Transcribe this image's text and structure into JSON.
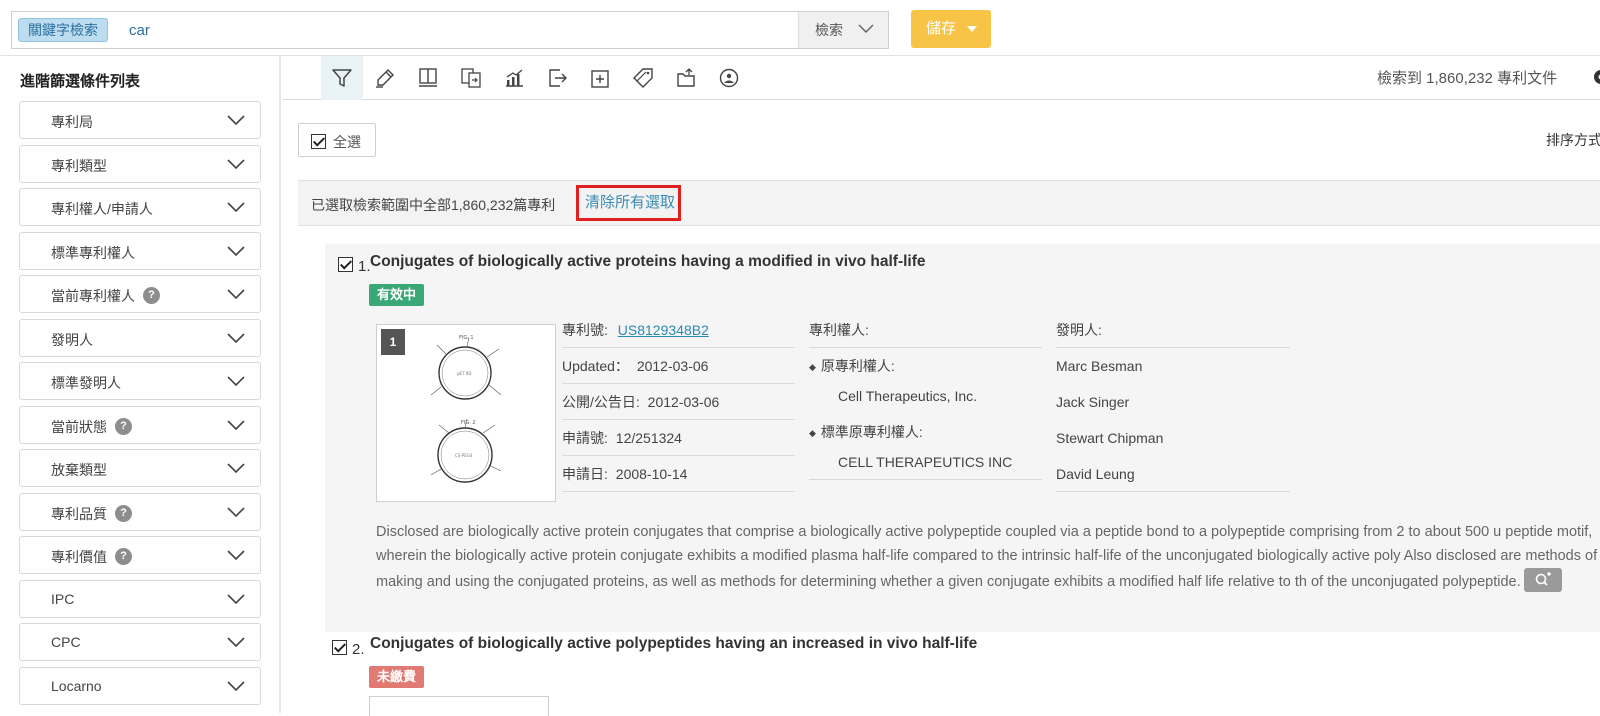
{
  "search": {
    "tag": "關鍵字檢索",
    "value": "car",
    "search_button": "檢索",
    "save_button": "儲存"
  },
  "sidebar": {
    "title": "進階篩選條件列表",
    "items": [
      {
        "label": "專利局",
        "help": false
      },
      {
        "label": "專利類型",
        "help": false
      },
      {
        "label": "專利權人/申請人",
        "help": false
      },
      {
        "label": "標準專利權人",
        "help": false
      },
      {
        "label": "當前專利權人",
        "help": true
      },
      {
        "label": "發明人",
        "help": false
      },
      {
        "label": "標準發明人",
        "help": false
      },
      {
        "label": "當前狀態",
        "help": true
      },
      {
        "label": "放棄類型",
        "help": false
      },
      {
        "label": "專利品質",
        "help": true
      },
      {
        "label": "專利價值",
        "help": true
      },
      {
        "label": "IPC",
        "help": false
      },
      {
        "label": "CPC",
        "help": false
      },
      {
        "label": "Locarno",
        "help": false
      }
    ]
  },
  "toolbar": {
    "tools": [
      "filter-icon",
      "highlighter-icon",
      "reader-icon",
      "compare-icon",
      "analysis-chart-icon",
      "export-icon",
      "add-icon",
      "tag-icon",
      "save-to-folder-icon",
      "monitor-icon"
    ],
    "result_count": "檢索到 1,860,232 專利文件"
  },
  "list": {
    "select_all": "全選",
    "sort_label": "排序方式",
    "selection_text": "已選取檢索範圍中全部1,860,232篇專利",
    "clear_selection": "清除所有選取"
  },
  "results": [
    {
      "num": "1.",
      "title": "Conjugates of biologically active proteins having a modified in vivo half-life",
      "status": "有效中",
      "status_color": "#3aa876",
      "thumb_num": "1",
      "patent_no_label": "專利號:",
      "patent_no": "US8129348B2",
      "updated_label": "Updated：",
      "updated": "2012-03-06",
      "pub_label": "公開/公告日:",
      "pub_date": "2012-03-06",
      "app_no_label": "申請號:",
      "app_no": "12/251324",
      "app_date_label": "申請日:",
      "app_date": "2008-10-14",
      "assignee_label": "專利權人:",
      "orig_assignee_label": "原專利權人:",
      "orig_assignee": "Cell Therapeutics, Inc.",
      "std_orig_assignee_label": "標準原專利權人:",
      "std_orig_assignee": "CELL THERAPEUTICS INC",
      "inventor_label": "發明人:",
      "inventors": [
        "Marc Besman",
        "Jack Singer",
        "Stewart Chipman",
        "David Leung"
      ],
      "abstract": "Disclosed are biologically active protein conjugates that comprise a biologically active polypeptide coupled via a peptide bond to a polypeptide comprising from 2 to about 500 u peptide motif, wherein the biologically active protein conjugate exhibits a modified plasma half-life compared to the intrinsic half-life of the unconjugated biologically active poly Also disclosed are methods of making and using the conjugated proteins, as well as methods for determining whether a given conjugate exhibits a modified half life relative to th of the unconjugated polypeptide."
    },
    {
      "num": "2.",
      "title": "Conjugates of biologically active polypeptides having an increased in vivo half-life",
      "status": "未繳費",
      "status_color": "#e07a72"
    }
  ]
}
